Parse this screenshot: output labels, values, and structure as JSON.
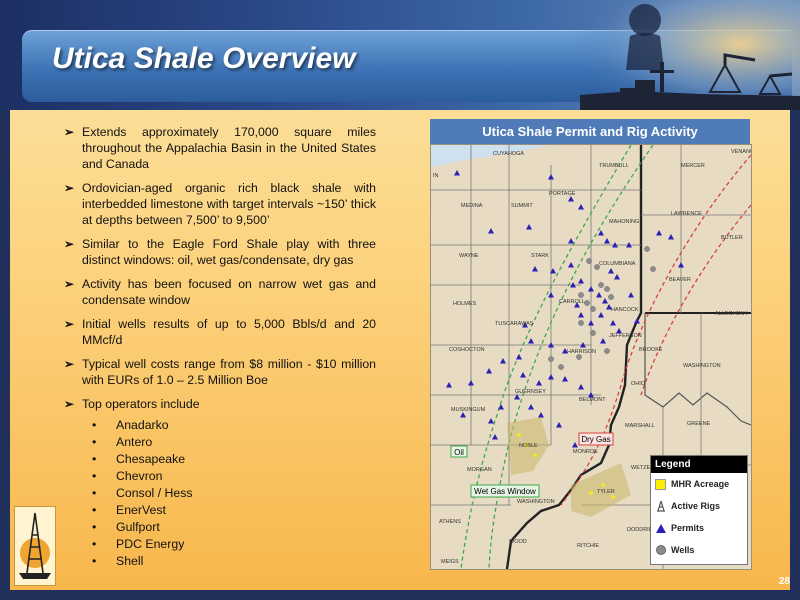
{
  "slide": {
    "title": "Utica Shale Overview",
    "page_number": "28"
  },
  "bullets": [
    "Extends approximately 170,000 square miles throughout the Appalachia Basin in the United States and Canada",
    "Ordovician-aged organic rich black shale with interbedded limestone with target intervals ~150’ thick at depths between 7,500’ to 9,500’",
    "Similar to the Eagle Ford Shale play with three distinct windows: oil, wet gas/condensate, dry gas",
    "Activity has been focused on narrow wet gas and condensate window",
    "Initial wells results of up to 5,000 Bbls/d and 20 MMcf/d",
    "Typical well costs range from $8 million - $10 million with EURs of 1.0 – 2.5 Million Boe",
    "Top operators include"
  ],
  "operators": [
    "Anadarko",
    "Antero",
    "Chesapeake",
    "Chevron",
    "Consol / Hess",
    "EnerVest",
    "Gulfport",
    "PDC Energy",
    "Shell"
  ],
  "map": {
    "title": "Utica Shale Permit and Rig Activity",
    "window_labels": {
      "oil": "Oil",
      "wet_gas": "Wet Gas Window",
      "dry_gas": "Dry Gas"
    },
    "counties": {
      "cuyahoga": "CUYAHOGA",
      "trumbull": "TRUMBULL",
      "mercer": "MERCER",
      "venango": "VENANGO",
      "portage": "PORTAGE",
      "summit": "SUMMIT",
      "medina": "MEDINA",
      "mahoning": "MAHONING",
      "lawrence": "LAWRENCE",
      "butler": "BUTLER",
      "wayne": "WAYNE",
      "stark": "STARK",
      "columbiana": "COLUMBIANA",
      "beaver": "BEAVER",
      "holmes": "HOLMES",
      "carroll": "CARROLL",
      "tuscarawas": "TUSCARAWAS",
      "hancock": "HANCOCK",
      "allegheny": "ALLEGHENY",
      "jefferson": "JEFFERSON",
      "coshocton": "COSHOCTON",
      "harrison": "HARRISON",
      "brooke": "BROOKE",
      "washington_pa": "WASHINGTON",
      "ohio": "OHIO",
      "guernsey": "GUERNSEY",
      "belmont": "BELMONT",
      "muskingum": "MUSKINGUM",
      "marshall": "MARSHALL",
      "greene": "GREENE",
      "noble": "NOBLE",
      "monroe": "MONROE",
      "morgan": "MORGAN",
      "wetzel": "WETZEL",
      "washington_oh": "WASHINGTON",
      "athens": "ATHENS",
      "tyler": "TYLER",
      "doddridge": "DODDRIDGE",
      "ritchie": "RITCHIE",
      "wood": "WOOD",
      "meigs": "MEIGS",
      "in": "IN"
    }
  },
  "legend": {
    "title": "Legend",
    "items": [
      {
        "label": "MHR Acreage",
        "color": "#ffee00"
      },
      {
        "label": "Active Rigs",
        "color": "#555555"
      },
      {
        "label": "Permits",
        "color": "#2b1fb5"
      },
      {
        "label": "Wells",
        "color": "#8c8c8c"
      }
    ]
  },
  "colors": {
    "header_dark": "#1d2f63",
    "banner": "#3e73b5",
    "body_top": "#fde5a8",
    "body_bottom": "#f8b64a",
    "permit": "#2b1fb5",
    "oil_line": "#3fa84a",
    "drygas_line": "#d9413b"
  }
}
